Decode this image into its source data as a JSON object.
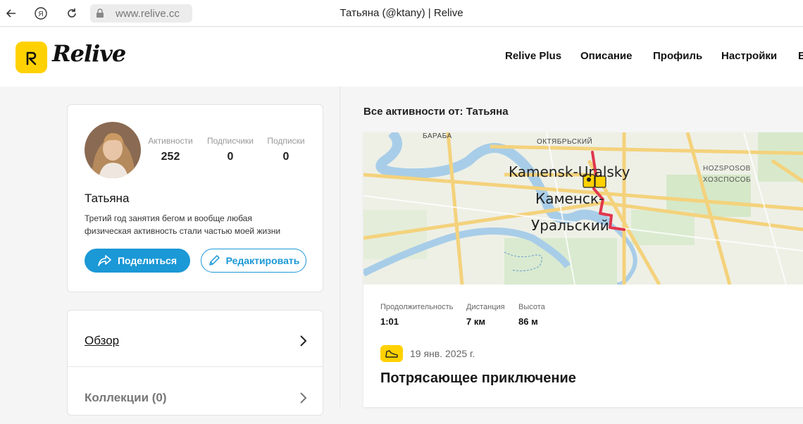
{
  "browser": {
    "url": "www.relive.cc",
    "tab_title": "Татьяна (@ktany) | Relive"
  },
  "header": {
    "logo_text": "Relive",
    "nav": [
      "Relive Plus",
      "Описание",
      "Профиль",
      "Настройки",
      "B"
    ]
  },
  "profile": {
    "stats": [
      {
        "label": "Активности",
        "value": "252"
      },
      {
        "label": "Подписчики",
        "value": "0"
      },
      {
        "label": "Подписки",
        "value": "0"
      }
    ],
    "name": "Татьяна",
    "bio": "Третий год занятия бегом и вообще любая физическая активность стали частью моей жизни",
    "share_label": "Поделиться",
    "edit_label": "Редактировать"
  },
  "menu": {
    "items": [
      {
        "label": "Обзор"
      },
      {
        "label": "Коллекции (0)"
      }
    ]
  },
  "feed": {
    "section_title": "Все активности от: Татьяна",
    "activity": {
      "map_labels": {
        "city_en": "Kamensk-Uralsky",
        "city_ru_1": "Каменск-",
        "city_ru_2": "Уральский",
        "district_1": "ОКТЯБРЬСКИЙ",
        "district_2": "БАРАБА",
        "district_3": "HOZSPOSOB",
        "district_4": "ХОЗСПОСОБ"
      },
      "metrics": [
        {
          "label": "Продолжительность",
          "value": "1:01"
        },
        {
          "label": "Дистанция",
          "value": "7 км"
        },
        {
          "label": "Высота",
          "value": "86 м"
        }
      ],
      "date": "19 янв. 2025 г.",
      "title": "Потрясающее приключение"
    }
  },
  "colors": {
    "brand_yellow": "#ffd100",
    "accent_blue": "#1b98d6",
    "route_red": "#e0364d"
  }
}
